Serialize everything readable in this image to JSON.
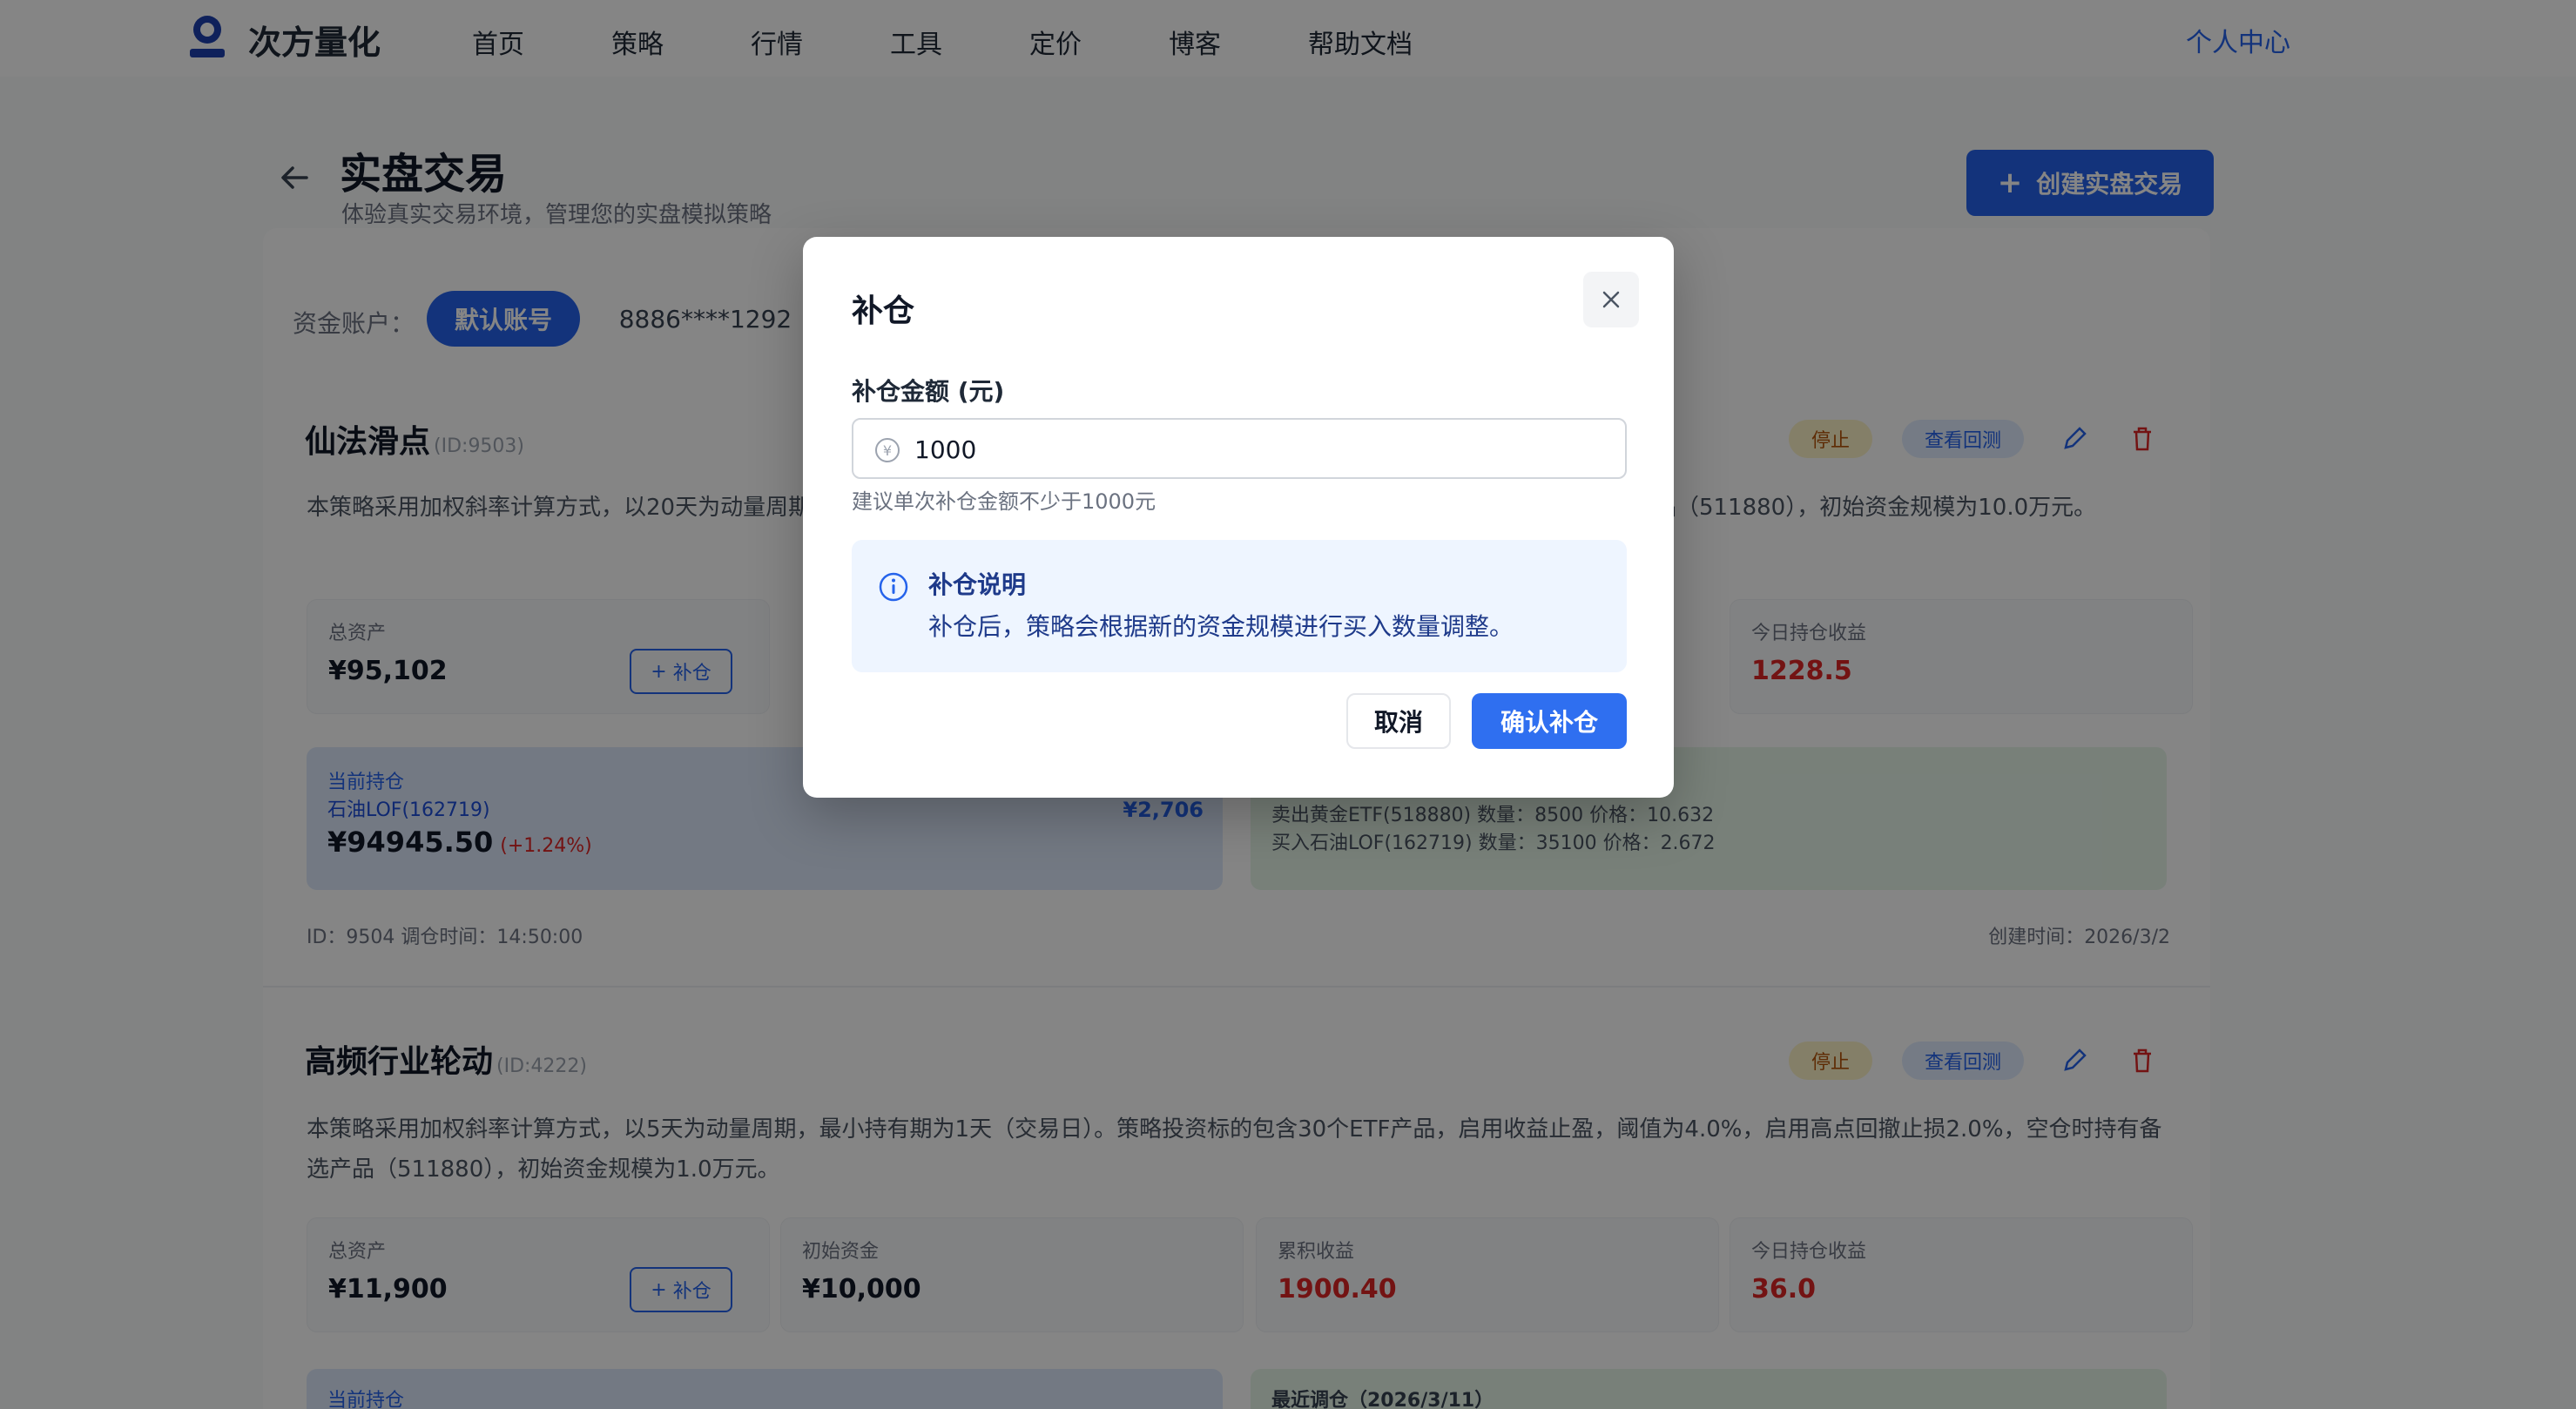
{
  "nav": {
    "brand": "次方量化",
    "items": [
      "首页",
      "策略",
      "行情",
      "工具",
      "定价",
      "博客",
      "帮助文档"
    ],
    "user": "个人中心"
  },
  "header": {
    "title": "实盘交易",
    "subtitle": "体验真实交易环境，管理您的实盘模拟策略",
    "create_button": "创建实盘交易"
  },
  "accounts": {
    "label": "资金账户：",
    "tabs": [
      "默认账号",
      "8886****1292"
    ]
  },
  "strategies": [
    {
      "name": "仙法滑点",
      "id": "(ID:9503)",
      "badge_stop": "停止",
      "badge_view": "查看回测",
      "description": "本策略采用加权斜率计算方式，以20天为动量周期，最小持有期为1天（交易日）。策略投资标的包含20个ETF产品，空仓时持有备选产品（511880），初始资金规模为10.0万元。",
      "metrics": [
        {
          "label": "总资产",
          "value": "¥95,102",
          "has_add": true,
          "add_label": "补仓"
        }
      ],
      "metrics_right": [
        {
          "label": "今日持仓收益",
          "value": "1228.5"
        }
      ],
      "position": {
        "label": "当前持仓",
        "name": "石油LOF(162719)",
        "value": "¥94945.50",
        "pct": "(+1.24%)",
        "amount": "¥2,706"
      },
      "trades": [
        "卖出黄金ETF(518880) 数量：8500 价格：10.632",
        "买入石油LOF(162719) 数量：35100 价格：2.672"
      ],
      "footer_left": "ID：9504    调仓时间：14:50:00",
      "footer_right": "创建时间：2026/3/2"
    },
    {
      "name": "高频行业轮动",
      "id": "(ID:4222)",
      "badge_stop": "停止",
      "badge_view": "查看回测",
      "description": "本策略采用加权斜率计算方式，以5天为动量周期，最小持有期为1天（交易日）。策略投资标的包含30个ETF产品，启用收益止盈，阈值为4.0%，启用高点回撤止损2.0%，空仓时持有备选产品（511880），初始资金规模为1.0万元。",
      "metrics": [
        {
          "label": "总资产",
          "value": "¥11,900",
          "has_add": true,
          "add_label": "补仓"
        },
        {
          "label": "初始资金",
          "value": "¥10,000"
        },
        {
          "label": "累积收益",
          "value": "1900.40",
          "red": true
        },
        {
          "label": "今日持仓收益",
          "value": "36.0",
          "red": true
        }
      ],
      "position": {
        "label": "当前持仓"
      },
      "trade_title": "最近调仓（2026/3/11）"
    }
  ],
  "modal": {
    "title": "补仓",
    "field_label": "补仓金额 (元)",
    "amount_value": "1000",
    "currency_symbol": "¥",
    "hint": "建议单次补仓金额不少于1000元",
    "info_title": "补仓说明",
    "info_text": "补仓后，策略会根据新的资金规模进行买入数量调整。",
    "cancel_label": "取消",
    "confirm_label": "确认补仓"
  }
}
